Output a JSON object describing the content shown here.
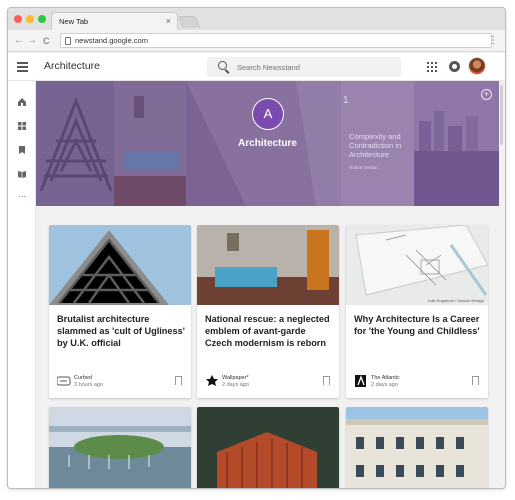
{
  "browser": {
    "tab_title": "New Tab",
    "tab_close": "×",
    "url": "newstand.google.com",
    "back": "←",
    "forward": "→",
    "reload": "C",
    "menu": "⋮"
  },
  "appbar": {
    "title": "Architecture",
    "search_placeholder": "Search Newsstand"
  },
  "hero": {
    "avatar_letter": "A",
    "title": "Architecture",
    "book_number": "1",
    "book_title": "Complexity and Contradiction in Architecture",
    "book_author": "Robert Venturi",
    "plus": "+"
  },
  "cards": [
    {
      "title": "Brutalist architecture slammed as 'cult of Ugliness' by U.K. official",
      "publisher": "Curbed",
      "time": "3 hours ago",
      "credit": ""
    },
    {
      "title": "National rescue: a neglected emblem of avant-garde Czech modernism is reborn",
      "publisher": "Wallpaper*",
      "time": "2 days ago",
      "credit": ""
    },
    {
      "title": "Why Architecture Is a Career for 'the Young and Childless'",
      "publisher": "The Atlantic",
      "time": "2 days ago",
      "credit": "Julie Engstrom / Voccon Design"
    }
  ],
  "colors": {
    "hero_overlay": "#5c3880",
    "avatar_purple": "#7c4bb0"
  }
}
